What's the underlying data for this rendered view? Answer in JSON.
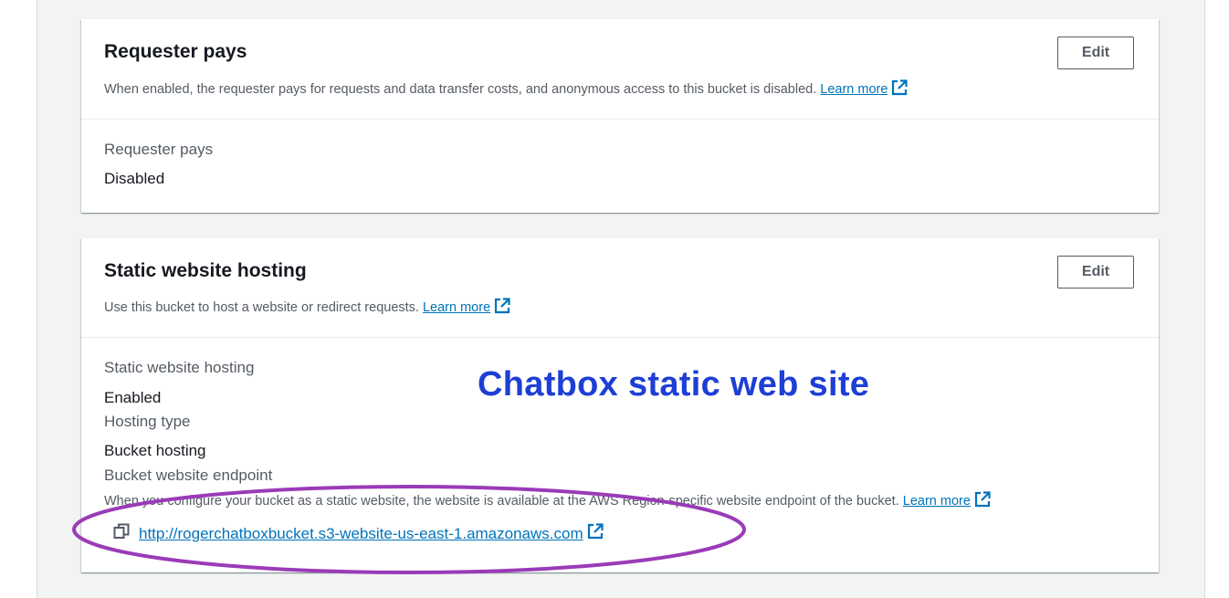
{
  "requester_pays": {
    "title": "Requester pays",
    "description": "When enabled, the requester pays for requests and data transfer costs, and anonymous access to this bucket is disabled.",
    "learn_more": "Learn more",
    "edit_label": "Edit",
    "field_label": "Requester pays",
    "field_value": "Disabled"
  },
  "static_hosting": {
    "title": "Static website hosting",
    "description": "Use this bucket to host a website or redirect requests.",
    "learn_more": "Learn more",
    "edit_label": "Edit",
    "status_label": "Static website hosting",
    "status_value": "Enabled",
    "type_label": "Hosting type",
    "type_value": "Bucket hosting",
    "endpoint_label": "Bucket website endpoint",
    "endpoint_help": "When you configure your bucket as a static website, the website is available at the AWS Region-specific website endpoint of the bucket.",
    "endpoint_help_learn_more": "Learn more",
    "endpoint_url": "http://rogerchatboxbucket.s3-website-us-east-1.amazonaws.com"
  },
  "annotation": {
    "overlay_text": "Chatbox static web site",
    "overlay_color": "#1d3fd6",
    "ellipse_color": "#9a3bb8"
  },
  "colors": {
    "link": "#0073bb",
    "page_background": "#f2f3f3"
  },
  "icons": [
    "external-link-icon",
    "copy-icon"
  ]
}
